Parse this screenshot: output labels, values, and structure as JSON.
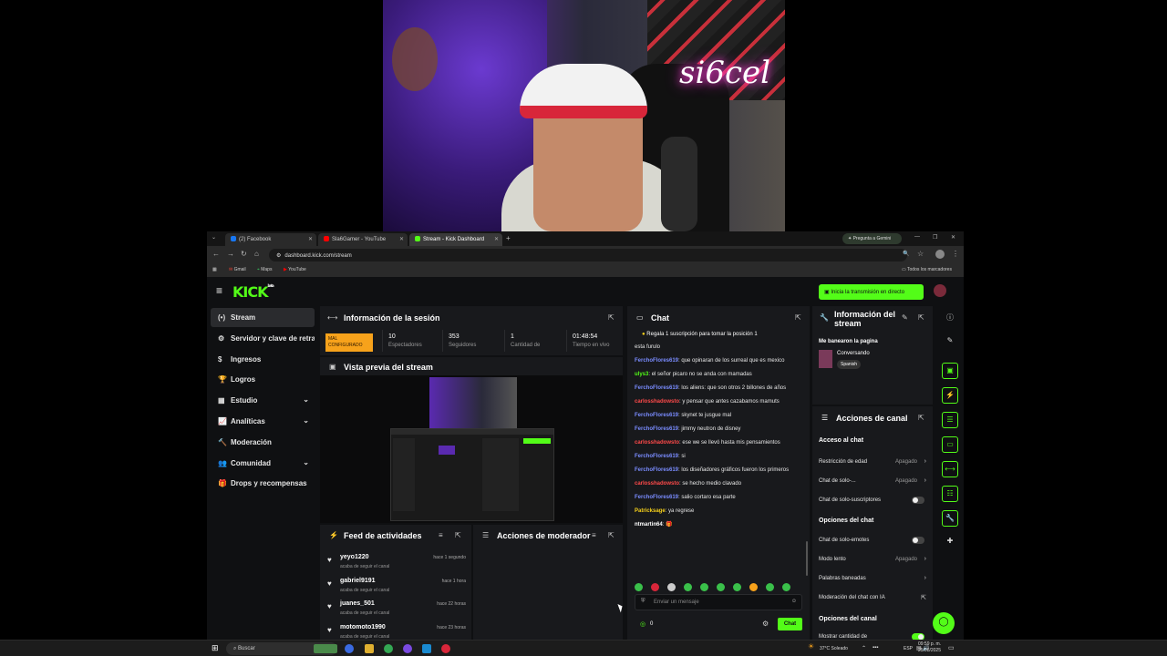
{
  "webcam": {
    "neon_text": "si6cel"
  },
  "browser": {
    "tabs": [
      {
        "label": "(2) Facebook",
        "color": "#1877f2"
      },
      {
        "label": "Sla6Gamer - YouTube",
        "color": "#ff0000"
      },
      {
        "label": "Stream - Kick Dashboard",
        "color": "#53fc18"
      }
    ],
    "new_tab": "+",
    "gemini": "Pregunta a Gemini",
    "url": "dashboard.kick.com/stream",
    "bookmarks": [
      "Gmail",
      "Maps",
      "YouTube"
    ],
    "all_bookmarks": "Todos los marcadores"
  },
  "kick": {
    "logo": "KICK",
    "logo_beta": "beta",
    "go_live": "Inicia la transmisión en directo",
    "sidebar": [
      {
        "label": "Stream",
        "icon": "(•)",
        "active": true,
        "chev": false
      },
      {
        "label": "Servidor y clave de retransmisión",
        "icon": "⚙",
        "chev": false
      },
      {
        "label": "Ingresos",
        "icon": "$",
        "chev": false
      },
      {
        "label": "Logros",
        "icon": "🏆",
        "chev": false
      },
      {
        "label": "Estudio",
        "icon": "▦",
        "chev": true
      },
      {
        "label": "Analíticas",
        "icon": "📈",
        "chev": true
      },
      {
        "label": "Moderación",
        "icon": "🔨",
        "chev": false
      },
      {
        "label": "Comunidad",
        "icon": "👥",
        "chev": true
      },
      {
        "label": "Drops y recompensas",
        "icon": "🎁",
        "chev": false
      }
    ],
    "session": {
      "title": "Información de la sesión",
      "status": "MAL CONFIGURADO",
      "stats": [
        {
          "value": "10",
          "label": "Espectadores"
        },
        {
          "value": "353",
          "label": "Seguidores"
        },
        {
          "value": "1",
          "label": "Cantidad de"
        },
        {
          "value": "01:48:54",
          "label": "Tiempo en vivo"
        }
      ]
    },
    "preview": {
      "title": "Vista previa del stream"
    },
    "feed": {
      "title": "Feed de actividades",
      "items": [
        {
          "user": "yeyo1220",
          "time": "hace 1 segundo",
          "desc": "acaba de seguir el canal"
        },
        {
          "user": "gabriel9191",
          "time": "hace 1 hora",
          "desc": "acaba de seguir el canal"
        },
        {
          "user": "juanes_501",
          "time": "hace 22 horas",
          "desc": "acaba de seguir el canal"
        },
        {
          "user": "motomoto1990",
          "time": "hace 23 horas",
          "desc": "acaba de seguir el canal"
        }
      ]
    },
    "mod": {
      "title": "Acciones de moderador"
    },
    "chat": {
      "title": "Chat",
      "pinned": "Regala 1 suscripción para tomar la posición 1",
      "messages": [
        {
          "user": "",
          "color": "#e6e6e6",
          "text": "esta furulo"
        },
        {
          "user": "FerchoFlores619",
          "color": "#7a8cff",
          "text": "que opinaran de los surreal que es mexico"
        },
        {
          "user": "ulys3",
          "color": "#53fc18",
          "text": "el señor picaro no se anda con mamadas"
        },
        {
          "user": "FerchoFlores619",
          "color": "#7a8cff",
          "text": "los aliens: que son otros 2 billones de años"
        },
        {
          "user": "carlosshadowsto",
          "color": "#ff4a4a",
          "text": "y pensar que antes cazabamos mamuts"
        },
        {
          "user": "FerchoFlores619",
          "color": "#7a8cff",
          "text": "skynet te jusgue mal"
        },
        {
          "user": "FerchoFlores619",
          "color": "#7a8cff",
          "text": "jimmy neutron de disney"
        },
        {
          "user": "carlosshadowsto",
          "color": "#ff4a4a",
          "text": "ese we se llevó hasta mis pensamientos"
        },
        {
          "user": "FerchoFlores619",
          "color": "#7a8cff",
          "text": "si"
        },
        {
          "user": "FerchoFlores619",
          "color": "#7a8cff",
          "text": "los diseñadores gráficos fueron los primeros"
        },
        {
          "user": "carlosshadowsto",
          "color": "#ff4a4a",
          "text": "se hecho medio clavado"
        },
        {
          "user": "FerchoFlores619",
          "color": "#7a8cff",
          "text": "salio cortaro esa parte"
        },
        {
          "user": "Patricksage",
          "color": "#f7d11b",
          "text": "ya regrese"
        },
        {
          "user": "ntmartin64",
          "color": "#ffffff",
          "text": "🎁"
        }
      ],
      "placeholder": "Enviar un mensaje",
      "count": "0",
      "send": "Chat"
    },
    "stream_info": {
      "title": "Información del stream",
      "stream_title": "Me banearon la pagina",
      "category": "Conversando",
      "language": "Spanish"
    },
    "channel_actions": {
      "title": "Acciones de canal",
      "chat_access": "Acceso al chat",
      "rows1": [
        {
          "label": "Restricción de edad",
          "value": "Apagado",
          "type": "arrow"
        },
        {
          "label": "Chat de solo-...",
          "value": "Apagado",
          "type": "arrow"
        },
        {
          "label": "Chat de solo-suscriptores",
          "value": "",
          "type": "toggle"
        }
      ],
      "chat_options": "Opciones del chat",
      "rows2": [
        {
          "label": "Chat de solo-emotes",
          "value": "",
          "type": "toggle"
        },
        {
          "label": "Modo lento",
          "value": "Apagado",
          "type": "arrow"
        },
        {
          "label": "Palabras baneadas",
          "value": "",
          "type": "arrow"
        },
        {
          "label": "Moderación del chat con IA",
          "value": "",
          "type": "ext"
        }
      ],
      "channel_options": "Opciones del canal",
      "rows3": [
        {
          "label": "Mostrar cantidad de",
          "value": "",
          "type": "toggle-on"
        }
      ]
    }
  },
  "taskbar": {
    "search": "Buscar",
    "weather": "37°C  Soleado",
    "lang": "ESP",
    "time": "09:59 p. m.",
    "date": "25/08/2025"
  }
}
